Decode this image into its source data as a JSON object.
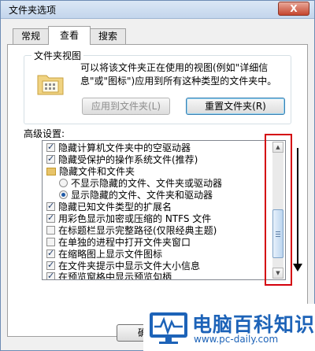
{
  "window": {
    "title": "文件夹选项",
    "close_glyph": "X"
  },
  "tabs": [
    {
      "label": "常规",
      "active": false
    },
    {
      "label": "查看",
      "active": true
    },
    {
      "label": "搜索",
      "active": false
    }
  ],
  "folder_views": {
    "label": "文件夹视图",
    "description": "可以将该文件夹正在使用的视图(例如\"详细信息\"或\"图标\")应用到所有这种类型的文件夹中。",
    "apply_button": "应用到文件夹(L)",
    "reset_button": "重置文件夹(R)"
  },
  "advanced": {
    "label": "高级设置:",
    "items": [
      {
        "type": "checkbox",
        "checked": true,
        "label": "隐藏计算机文件夹中的空驱动器"
      },
      {
        "type": "checkbox",
        "checked": true,
        "label": "隐藏受保护的操作系统文件(推荐)"
      },
      {
        "type": "folder",
        "label": "隐藏文件和文件夹"
      },
      {
        "type": "radio",
        "checked": false,
        "label": "不显示隐藏的文件、文件夹或驱动器"
      },
      {
        "type": "radio",
        "checked": true,
        "label": "显示隐藏的文件、文件夹和驱动器"
      },
      {
        "type": "checkbox",
        "checked": true,
        "label": "隐藏已知文件类型的扩展名"
      },
      {
        "type": "checkbox",
        "checked": true,
        "label": "用彩色显示加密或压缩的 NTFS 文件"
      },
      {
        "type": "checkbox",
        "checked": false,
        "label": "在标题栏显示完整路径(仅限经典主题)"
      },
      {
        "type": "checkbox",
        "checked": false,
        "label": "在单独的进程中打开文件夹窗口"
      },
      {
        "type": "checkbox",
        "checked": true,
        "label": "在缩略图上显示文件图标"
      },
      {
        "type": "checkbox",
        "checked": true,
        "label": "在文件夹提示中显示文件大小信息"
      },
      {
        "type": "checkbox",
        "checked": true,
        "label": "在预览窗格中显示预览句柄"
      }
    ],
    "scroll_up_glyph": "▲",
    "scroll_down_glyph": "▼"
  },
  "footer": {
    "ok_button": "确定"
  },
  "watermark": {
    "title": "电脑百科知识",
    "url": "www.pc-daily.com"
  },
  "colors": {
    "highlight_box": "#d4000c",
    "watermark_blue": "#1d63b8"
  }
}
